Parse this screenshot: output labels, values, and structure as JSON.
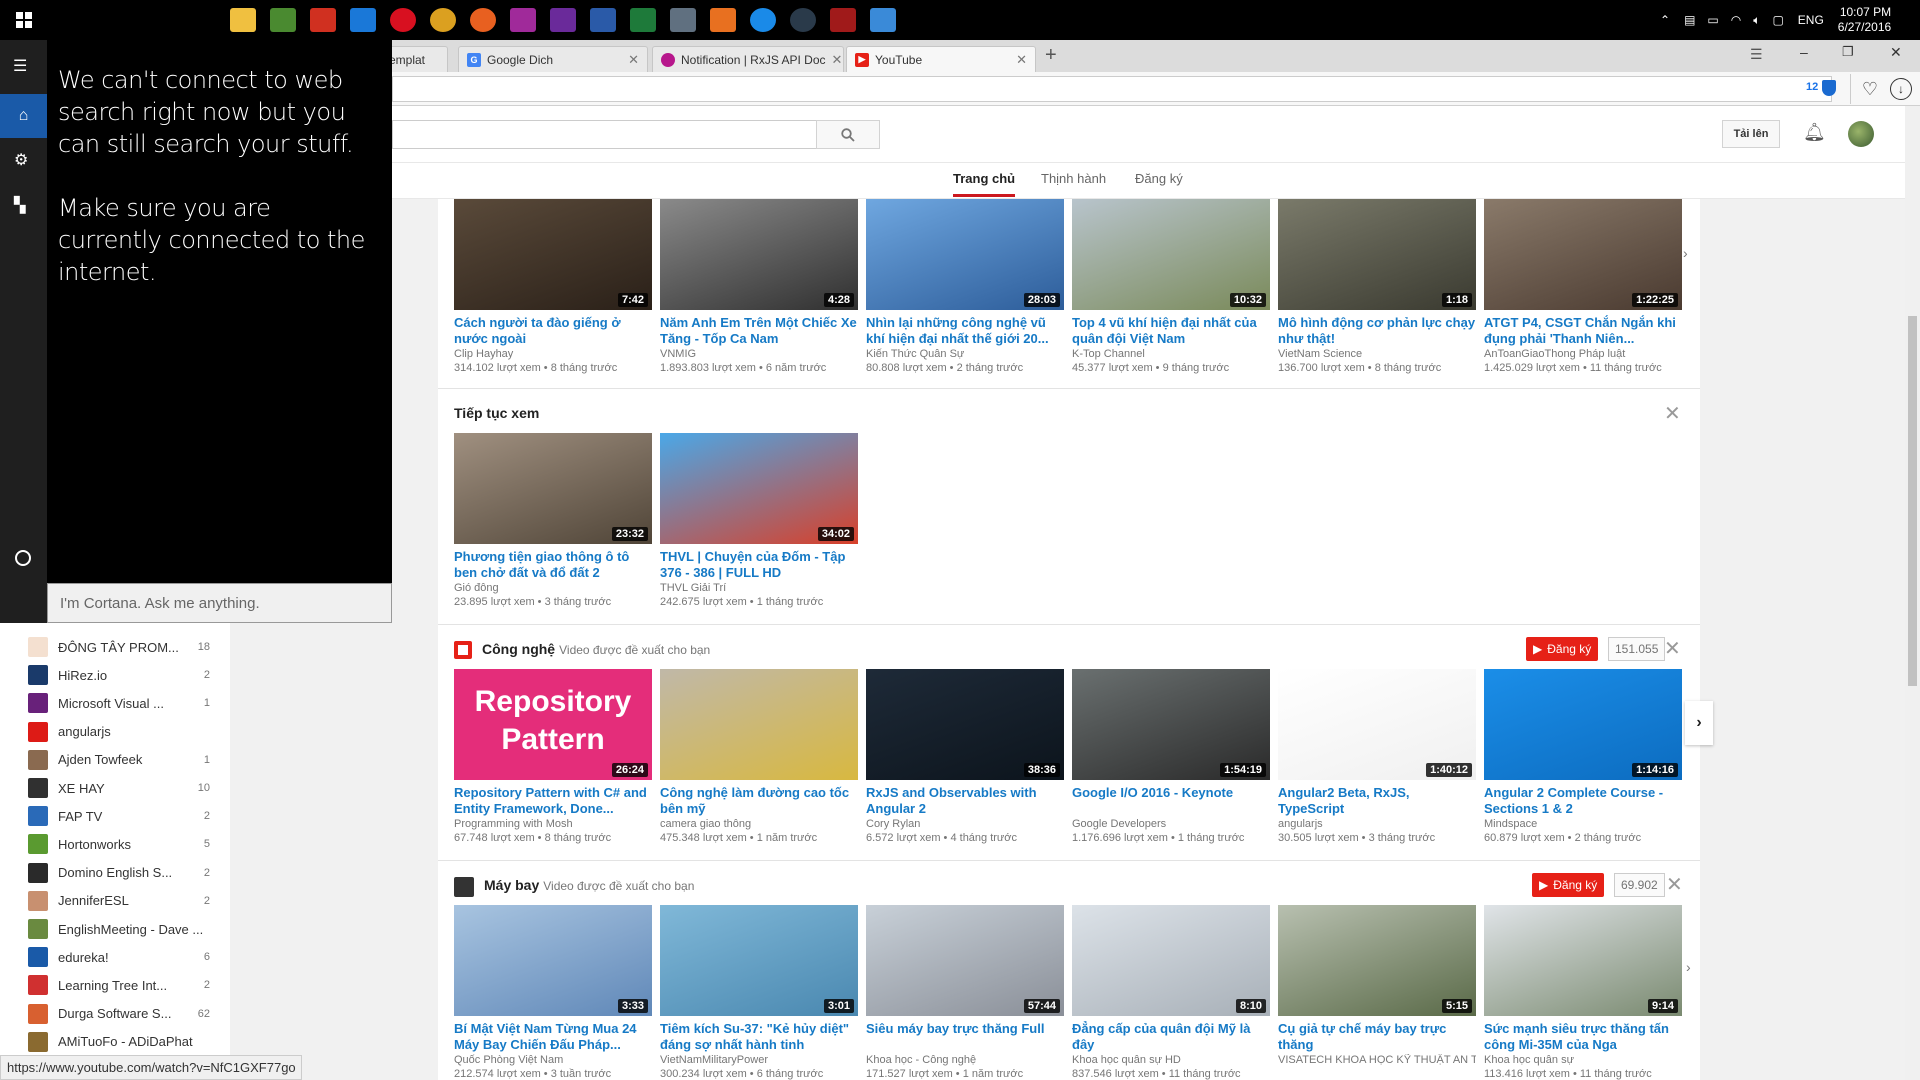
{
  "taskbar": {
    "clock_time": "10:07 PM",
    "clock_date": "6/27/2016",
    "language": "ENG",
    "apps": [
      "file-explorer",
      "notepad",
      "adobe-acrobat",
      "edge",
      "opera",
      "chrome",
      "firefox",
      "onenote",
      "visual-studio",
      "word",
      "excel",
      "tools",
      "orange-app",
      "skype",
      "steam",
      "dota",
      "remote-desktop"
    ]
  },
  "browser": {
    "tabs": [
      {
        "label": "emplat",
        "favicon": "doc"
      },
      {
        "label": "Google Dich",
        "favicon": "google-translate"
      },
      {
        "label": "Notification | RxJS API Doc",
        "favicon": "rxjs"
      },
      {
        "label": "YouTube",
        "favicon": "youtube"
      }
    ],
    "ext_badge": "12",
    "status_url": "https://www.youtube.com/watch?v=NfC1GXF77go"
  },
  "youtube": {
    "upload_label": "Tải lên",
    "nav": [
      "Trang chủ",
      "Thịnh hành",
      "Đăng ký"
    ],
    "row1": [
      {
        "title": "Cách người ta đào giếng ở nước ngoài",
        "channel": "Clip Hayhay",
        "meta": "314.102 lượt xem  •  8 tháng trước",
        "duration": "7:42",
        "c1": "#5a4a3a",
        "c2": "#2a2018"
      },
      {
        "title": "Năm Anh Em Trên Một Chiếc Xe Tăng - Tốp Ca Nam",
        "channel": "VNMIG",
        "meta": "1.893.803 lượt xem  •  6 năm trước",
        "duration": "4:28",
        "c1": "#8a8a8a",
        "c2": "#303030"
      },
      {
        "title": "Nhìn lại những công nghệ vũ khí hiện đại nhất thế giới 20...",
        "channel": "Kiến Thức Quân Sự",
        "meta": "80.808 lượt xem  •  2 tháng trước",
        "duration": "28:03",
        "c1": "#6fa7e0",
        "c2": "#2d5d9a"
      },
      {
        "title": "Top 4 vũ khí hiện đại nhất của quân đội Việt Nam",
        "channel": "K-Top Channel",
        "meta": "45.377 lượt xem  •  9 tháng trước",
        "duration": "10:32",
        "c1": "#b8c4cc",
        "c2": "#7a8a5a"
      },
      {
        "title": "Mô hình động cơ phản lực chạy như thật!",
        "channel": "VietNam Science",
        "meta": "136.700 lượt xem  •  8 tháng trước",
        "duration": "1:18",
        "c1": "#7a7a6a",
        "c2": "#3a3a30"
      },
      {
        "title": "ATGT P4, CSGT Chắn Ngắn khi đụng phải 'Thanh Niên...",
        "channel": "AnToanGiaoThong Pháp luật",
        "meta": "1.425.029 lượt xem  •  11 tháng trước",
        "duration": "1:22:25",
        "c1": "#8a7a6a",
        "c2": "#4a3a30"
      }
    ],
    "continue": {
      "title": "Tiếp tục xem",
      "videos": [
        {
          "title": "Phương tiện giao thông ô tô ben chở đất và đổ đất 2",
          "channel": "Gió đông",
          "meta": "23.895 lượt xem  •  3 tháng trước",
          "duration": "23:32",
          "c1": "#a09080",
          "c2": "#504538"
        },
        {
          "title": "THVL | Chuyện của Đốm - Tập 376 - 386 | FULL HD",
          "channel": "THVL Giải Trí",
          "meta": "242.675 lượt xem  •  1 tháng trước",
          "duration": "34:02",
          "c1": "#4aa8e8",
          "c2": "#d8402a"
        }
      ]
    },
    "tech": {
      "title": "Công nghệ",
      "subtitle": "Video được đề xuất cho bạn",
      "subscribe": "Đăng ký",
      "count": "151.055",
      "videos": [
        {
          "title": "Repository Pattern with C# and Entity Framework, Done...",
          "channel": "Programming with Mosh",
          "meta": "67.748 lượt xem  •  8 tháng trước",
          "duration": "26:24",
          "c1": "#e42d7a",
          "c2": "#e42d7a",
          "overlay": "Repository Pattern"
        },
        {
          "title": "Công nghệ làm đường cao tốc bên mỹ",
          "channel": "camera giao thông",
          "meta": "475.348 lượt xem  •  1 năm trước",
          "duration": "",
          "c1": "#c0b8a8",
          "c2": "#d8b840"
        },
        {
          "title": "RxJS and Observables with Angular 2",
          "channel": "Cory Rylan",
          "meta": "6.572 lượt xem  •  4 tháng trước",
          "duration": "38:36",
          "c1": "#1e2a38",
          "c2": "#0c141c"
        },
        {
          "title": "Google I/O 2016 - Keynote",
          "channel": "Google Developers",
          "meta": "1.176.696 lượt xem  •  1 tháng trước",
          "duration": "1:54:19",
          "c1": "#6a7070",
          "c2": "#2a2a2a"
        },
        {
          "title": "Angular2 Beta, RxJS, TypeScript",
          "channel": "angularjs",
          "meta": "30.505 lượt xem  •  3 tháng trước",
          "duration": "1:40:12",
          "c1": "#ffffff",
          "c2": "#f0f0f0"
        },
        {
          "title": "Angular 2 Complete Course - Sections 1 & 2",
          "channel": "Mindspace",
          "meta": "60.879 lượt xem  •  2 tháng trước",
          "duration": "1:14:16",
          "c1": "#1b8ee8",
          "c2": "#0c6cc0"
        }
      ]
    },
    "plane": {
      "title": "Máy bay",
      "subtitle": "Video được đề xuất cho bạn",
      "subscribe": "Đăng ký",
      "count": "69.902",
      "videos": [
        {
          "title": "Bí Mật Việt Nam Từng Mua 24 Máy Bay Chiến Đấu Pháp...",
          "channel": "Quốc Phòng Việt Nam",
          "meta": "212.574 lượt xem  •  3 tuần trước",
          "duration": "3:33",
          "c1": "#a8c4e0",
          "c2": "#6088b8"
        },
        {
          "title": "Tiêm kích Su-37: \"Kẻ hủy diệt\" đáng sợ nhất hành tinh",
          "channel": "VietNamMilitaryPower",
          "meta": "300.234 lượt xem  •  6 tháng trước",
          "duration": "3:01",
          "c1": "#80b8d8",
          "c2": "#4a88b0"
        },
        {
          "title": "Siêu máy bay trực thăng Full",
          "channel": "Khoa học - Công nghệ",
          "meta": "171.527 lượt xem  •  1 năm trước",
          "duration": "57:44",
          "c1": "#c8d0d8",
          "c2": "#8a8f98"
        },
        {
          "title": "Đẳng cấp của quân đội Mỹ là đây",
          "channel": "Khoa học quân sự HD",
          "meta": "837.546 lượt xem  •  11 tháng trước",
          "duration": "8:10",
          "c1": "#dce2e8",
          "c2": "#a8b0b8"
        },
        {
          "title": "Cụ giả tự chế máy bay trực thăng",
          "channel": "VISATECH KHOA HỌC KỸ THUẬT AN TOÀN VIỆT NAM",
          "meta": "",
          "duration": "5:15",
          "c1": "#b8c0b0",
          "c2": "#5a6a48"
        },
        {
          "title": "Sức mạnh siêu trực thăng tấn công Mi-35M của Nga",
          "channel": "Khoa học quân sự",
          "meta": "113.416 lượt xem  •  11 tháng trước",
          "duration": "9:14",
          "c1": "#e0e4e8",
          "c2": "#7a8a70"
        }
      ]
    }
  },
  "guide": [
    {
      "label": "ĐÔNG TÂY PROM...",
      "count": "18",
      "color": "#f4e0d0"
    },
    {
      "label": "HiRez.io",
      "count": "2",
      "color": "#1a3a6a"
    },
    {
      "label": "Microsoft Visual ...",
      "count": "1",
      "color": "#68217a"
    },
    {
      "label": "angularjs",
      "count": "",
      "color": "#dd1b16"
    },
    {
      "label": "Ajden Towfeek",
      "count": "1",
      "color": "#8a6a50"
    },
    {
      "label": "XE HAY",
      "count": "10",
      "color": "#303030"
    },
    {
      "label": "FAP TV",
      "count": "2",
      "color": "#2a6ab8"
    },
    {
      "label": "Hortonworks",
      "count": "5",
      "color": "#5a9a30"
    },
    {
      "label": "Domino English S...",
      "count": "2",
      "color": "#2a2a2a"
    },
    {
      "label": "JenniferESL",
      "count": "2",
      "color": "#c89070"
    },
    {
      "label": "EnglishMeeting - Dave ...",
      "count": "",
      "color": "#6a8a40"
    },
    {
      "label": "edureka!",
      "count": "6",
      "color": "#1a5aa8"
    },
    {
      "label": "Learning Tree Int...",
      "count": "2",
      "color": "#d03030"
    },
    {
      "label": "Durga Software S...",
      "count": "62",
      "color": "#d86030"
    },
    {
      "label": "AMiTuoFo - ADiDaPhat",
      "count": "",
      "color": "#8a6a30"
    }
  ],
  "cortana": {
    "message1": "We can't connect to web search right now but you can still search your stuff.",
    "message2": "Make sure you are currently connected to the internet.",
    "placeholder": "I'm Cortana. Ask me anything."
  }
}
